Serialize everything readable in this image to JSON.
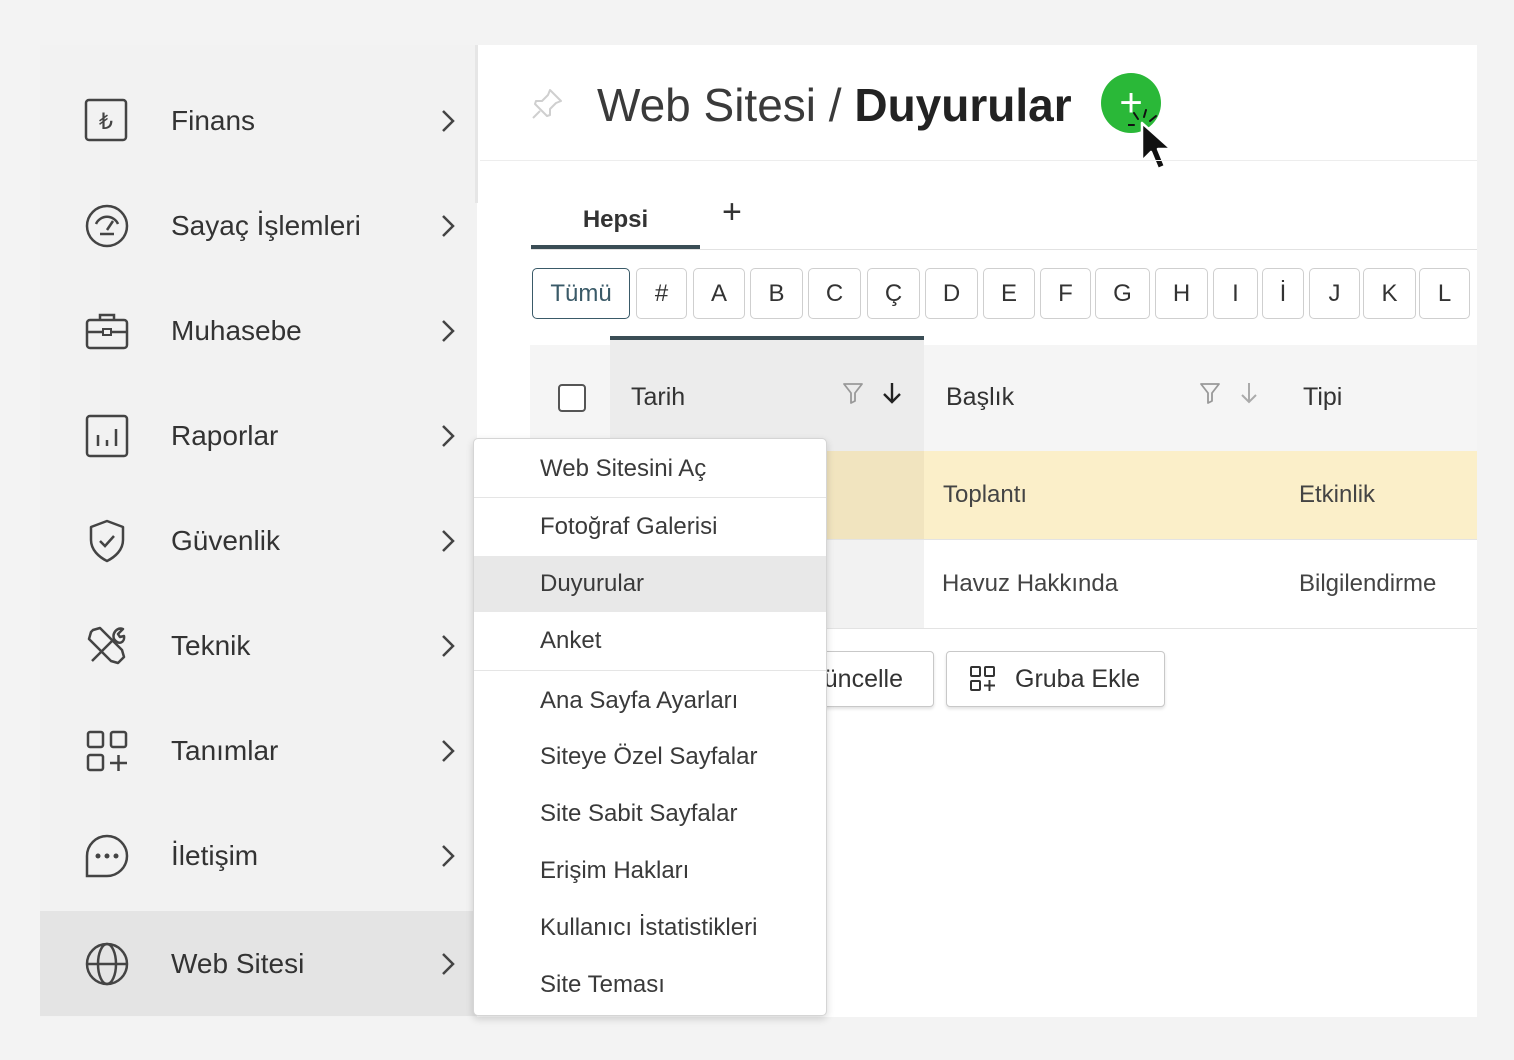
{
  "sidebar": {
    "items": [
      {
        "label": "Finans",
        "icon": "lira-icon"
      },
      {
        "label": "Sayaç İşlemleri",
        "icon": "meter-icon"
      },
      {
        "label": "Muhasebe",
        "icon": "briefcase-icon"
      },
      {
        "label": "Raporlar",
        "icon": "bar-chart-icon"
      },
      {
        "label": "Güvenlik",
        "icon": "shield-icon"
      },
      {
        "label": "Teknik",
        "icon": "tools-icon"
      },
      {
        "label": "Tanımlar",
        "icon": "grid-plus-icon"
      },
      {
        "label": "İletişim",
        "icon": "chat-icon"
      },
      {
        "label": "Web Sitesi",
        "icon": "globe-icon"
      }
    ],
    "active": "Web Sitesi",
    "lira_symbol": "₺"
  },
  "header": {
    "title_prefix": "Web Sitesi / ",
    "title_strong": "Duyurular",
    "add_symbol": "+"
  },
  "tabs": {
    "items": [
      {
        "label": "Hepsi"
      }
    ],
    "add_symbol": "+"
  },
  "letters": [
    "Tümü",
    "#",
    "A",
    "B",
    "C",
    "Ç",
    "D",
    "E",
    "F",
    "G",
    "H",
    "I",
    "İ",
    "J",
    "K",
    "L"
  ],
  "table": {
    "columns": [
      "Tarih",
      "Başlık",
      "Tipi"
    ],
    "rows": [
      {
        "baslik": "Toplantı",
        "tipi": "Etkinlik"
      },
      {
        "baslik": "Havuz Hakkında",
        "tipi": "Bilgilendirme"
      }
    ]
  },
  "buttons": {
    "update_partial": "üncelle",
    "group_add": "Gruba Ekle"
  },
  "dropdown": {
    "items": [
      "Web Sitesini Aç",
      "Fotoğraf Galerisi",
      "Duyurular",
      "Anket",
      "Ana Sayfa Ayarları",
      "Siteye Özel Sayfalar",
      "Site Sabit Sayfalar",
      "Erişim Hakları",
      "Kullanıcı İstatistikleri",
      "Site Teması"
    ],
    "active": "Duyurular"
  },
  "colors": {
    "accent_green": "#2ab838",
    "tab_underline": "#3a4d55",
    "highlight_row": "#fbefc9"
  }
}
